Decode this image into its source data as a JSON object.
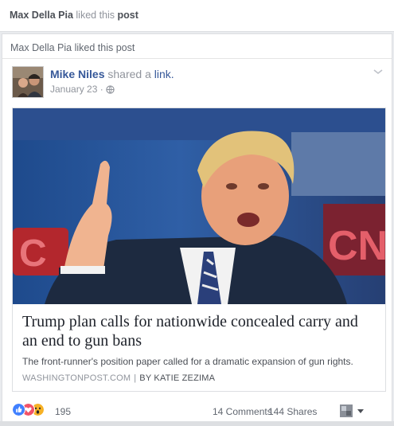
{
  "notification": {
    "actor": "Max Della Pia",
    "verb": "liked this",
    "object": "post"
  },
  "card": {
    "liked_line": "Max Della Pia liked this post",
    "author": {
      "name": "Mike Niles",
      "verb": "shared a",
      "object": "link."
    },
    "date": "January 23 ·",
    "link": {
      "title": "Trump plan calls for nationwide concealed carry and an end to gun bans",
      "description": "The front-runner's position paper called for a dramatic expansion of gun rights.",
      "source": "WASHINGTONPOST.COM",
      "separator": "|",
      "byline": "BY KATIE ZEZIMA"
    },
    "stats": {
      "reactions": "195",
      "comments": "14 Comments",
      "shares": "144 Shares"
    }
  },
  "colors": {
    "link_blue": "#365899",
    "like_blue": "#4080ff",
    "love_red": "#f25268",
    "haha_yellow": "#f7b125"
  },
  "icons": [
    "globe-icon",
    "chevron-down-icon",
    "like-reaction-icon",
    "love-reaction-icon",
    "wow-reaction-icon",
    "caret-down-icon"
  ]
}
